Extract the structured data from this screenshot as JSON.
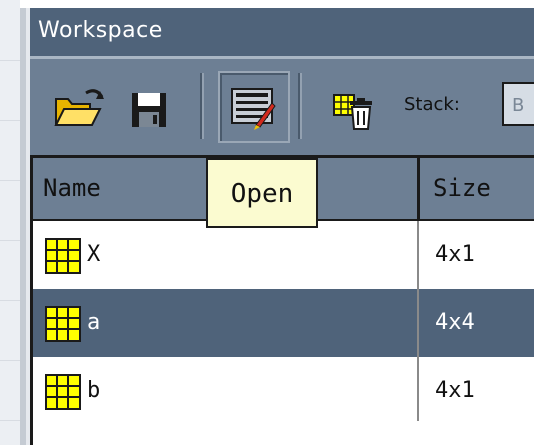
{
  "window": {
    "title": "Workspace"
  },
  "toolbar": {
    "buttons": [
      {
        "icon": "open-folder-icon"
      },
      {
        "icon": "save-icon"
      },
      {
        "icon": "import-data-icon",
        "pressed": true
      },
      {
        "icon": "delete-icon"
      }
    ],
    "stack_label": "Stack:",
    "stack_value": "B"
  },
  "tooltip": {
    "text": "Open"
  },
  "table": {
    "columns": [
      "Name",
      "Size"
    ],
    "rows": [
      {
        "name": "X",
        "size": "4x1",
        "selected": false,
        "icon": "matrix-icon"
      },
      {
        "name": "a",
        "size": "4x4",
        "selected": true,
        "icon": "matrix-icon"
      },
      {
        "name": "b",
        "size": "4x1",
        "selected": false,
        "icon": "matrix-icon"
      }
    ]
  },
  "colors": {
    "title_bar": "#4f637a",
    "toolbar": "#6d7f94",
    "selection": "#4f637a",
    "tooltip_bg": "#fbfbd0",
    "matrix_icon": "#ffff00"
  }
}
